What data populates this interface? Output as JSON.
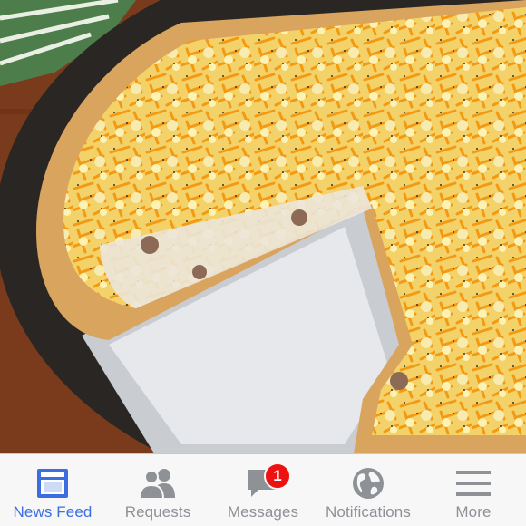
{
  "tabbar": {
    "tabs": [
      {
        "label": "News Feed",
        "icon": "news-feed-icon",
        "active": true
      },
      {
        "label": "Requests",
        "icon": "requests-icon"
      },
      {
        "label": "Messages",
        "icon": "messages-icon",
        "badge": "1"
      },
      {
        "label": "Notifications",
        "icon": "globe-icon"
      },
      {
        "label": "More",
        "icon": "menu-icon"
      }
    ]
  },
  "colors": {
    "active": "#3b6fe0",
    "inactive": "#8e9196",
    "badge": "#ee1111"
  }
}
